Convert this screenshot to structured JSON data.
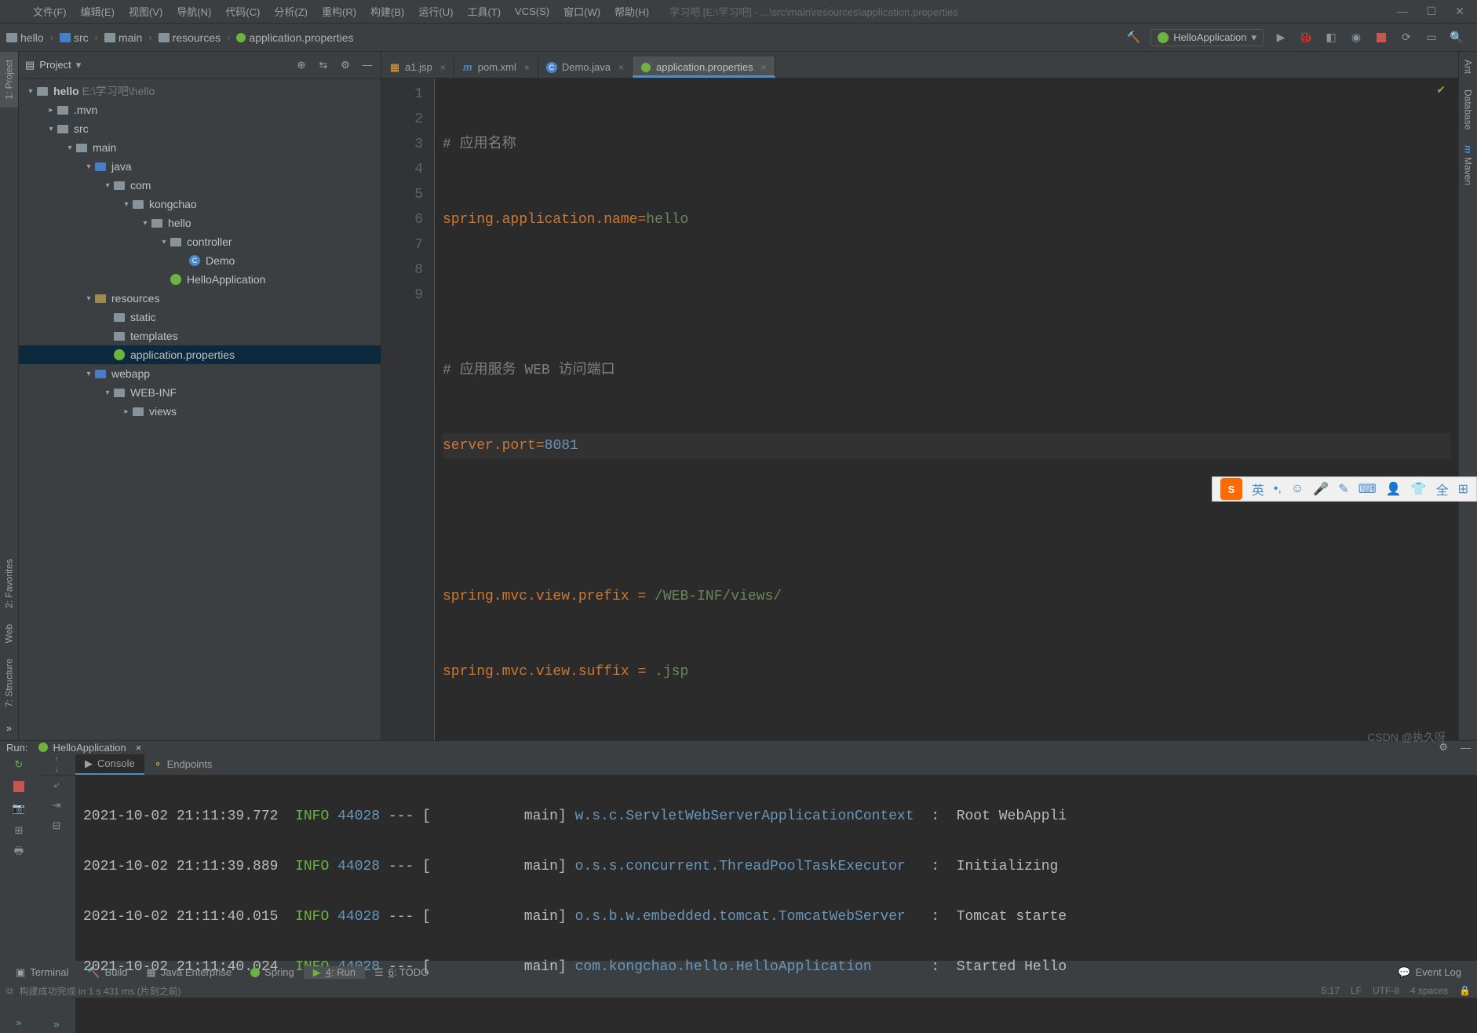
{
  "menubar": {
    "items": [
      "文件(F)",
      "编辑(E)",
      "视图(V)",
      "导航(N)",
      "代码(C)",
      "分析(Z)",
      "重构(R)",
      "构建(B)",
      "运行(U)",
      "工具(T)",
      "VCS(S)",
      "窗口(W)",
      "帮助(H)"
    ],
    "title": "学习吧 [E:\\学习吧] - ...\\src\\main\\resources\\application.properties"
  },
  "breadcrumbs": [
    "hello",
    "src",
    "main",
    "resources",
    "application.properties"
  ],
  "run_config": "HelloApplication",
  "project_panel": {
    "title": "Project",
    "tree": {
      "root": {
        "label": "hello",
        "path": "E:\\学习吧\\hello"
      },
      "mvn": ".mvn",
      "src": "src",
      "main": "main",
      "java": "java",
      "com": "com",
      "kongchao": "kongchao",
      "hello": "hello",
      "controller": "controller",
      "demo": "Demo",
      "helloApp": "HelloApplication",
      "resources": "resources",
      "static": "static",
      "templates": "templates",
      "appprops": "application.properties",
      "webapp": "webapp",
      "webinf": "WEB-INF",
      "views": "views"
    }
  },
  "tabs": [
    {
      "label": "a1.jsp",
      "icon": "jsp"
    },
    {
      "label": "pom.xml",
      "icon": "maven"
    },
    {
      "label": "Demo.java",
      "icon": "class"
    },
    {
      "label": "application.properties",
      "icon": "spring"
    }
  ],
  "editor": {
    "lines": [
      {
        "n": "1",
        "type": "comment",
        "text": "# 应用名称"
      },
      {
        "n": "2",
        "type": "kv",
        "key": "spring.application.name",
        "val": "hello"
      },
      {
        "n": "3",
        "type": "blank",
        "text": ""
      },
      {
        "n": "4",
        "type": "comment",
        "text": "# 应用服务 WEB 访问端口"
      },
      {
        "n": "5",
        "type": "kvnum",
        "key": "server.port",
        "val": "8081"
      },
      {
        "n": "6",
        "type": "blank",
        "text": ""
      },
      {
        "n": "7",
        "type": "kv2",
        "key": "spring.mvc.view.prefix",
        "val": "/WEB-INF/views/"
      },
      {
        "n": "8",
        "type": "kv2",
        "key": "spring.mvc.view.suffix",
        "val": ".jsp"
      },
      {
        "n": "9",
        "type": "blank",
        "text": ""
      }
    ]
  },
  "left_tabs": [
    "1: Project",
    "2: Favorites",
    "Web",
    "7: Structure"
  ],
  "right_tabs": [
    "Ant",
    "Database",
    "Maven"
  ],
  "run": {
    "label": "Run:",
    "title": "HelloApplication",
    "sub_tabs": [
      "Console",
      "Endpoints"
    ],
    "logs": [
      {
        "ts": "2021-10-02 21:11:39.772",
        "lvl": "INFO",
        "pid": "44028",
        "sep": "--- [",
        "thread": "main]",
        "cls": "w.s.c.ServletWebServerApplicationContext",
        "col": ":",
        "msg": "Root WebAppli"
      },
      {
        "ts": "2021-10-02 21:11:39.889",
        "lvl": "INFO",
        "pid": "44028",
        "sep": "--- [",
        "thread": "main]",
        "cls": "o.s.s.concurrent.ThreadPoolTaskExecutor",
        "col": ":",
        "msg": "Initializing"
      },
      {
        "ts": "2021-10-02 21:11:40.015",
        "lvl": "INFO",
        "pid": "44028",
        "sep": "--- [",
        "thread": "main]",
        "cls": "o.s.b.w.embedded.tomcat.TomcatWebServer",
        "col": ":",
        "msg": "Tomcat starte"
      },
      {
        "ts": "2021-10-02 21:11:40.024",
        "lvl": "INFO",
        "pid": "44028",
        "sep": "--- [",
        "thread": "main]",
        "cls": "com.kongchao.hello.HelloApplication",
        "col": ":",
        "msg": "Started Hello"
      }
    ]
  },
  "bottom_tabs": {
    "terminal": "Terminal",
    "build": "Build",
    "jee": "Java Enterprise",
    "spring": "Spring",
    "run": "4: Run",
    "todo": "6: TODO",
    "eventlog": "Event Log"
  },
  "status": {
    "build_msg": "构建成功完成 in 1 s 431 ms (片刻之前)",
    "cursor": "5:17",
    "line_sep": "LF",
    "encoding": "UTF-8",
    "indent": "4 spaces"
  },
  "ime": {
    "lang": "英",
    "full": "全"
  },
  "watermark": "CSDN @执久呀"
}
